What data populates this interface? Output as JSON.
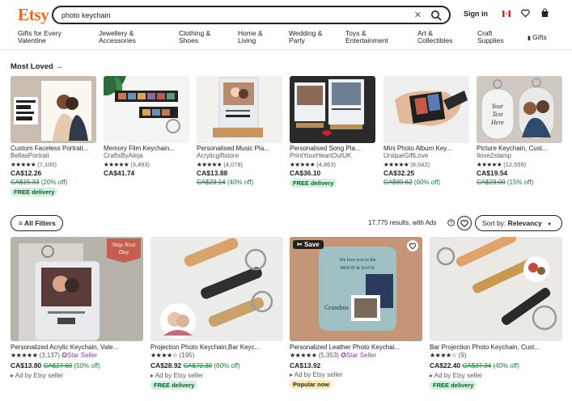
{
  "header": {
    "logo": "Etsy",
    "search_value": "photo keychain",
    "signin": "Sign in"
  },
  "nav": [
    "Gifts for Every Valentine",
    "Jewellery & Accessories",
    "Clothing & Shoes",
    "Home & Living",
    "Wedding & Party",
    "Toys & Entertainment",
    "Art & Collectibles",
    "Craft Supplies",
    "Gifts"
  ],
  "most_loved": {
    "heading": "Most Loved →",
    "items": [
      {
        "title": "Custom Faceless Portrait...",
        "shop": "BellasPortrait",
        "stars": "★★★★★",
        "reviews": "(7,100)",
        "price": "CA$12.26",
        "was": "CA$15.33",
        "discount": "(20% off)",
        "badge": "FREE delivery",
        "badge_type": "green"
      },
      {
        "title": "Memory Film Keychain...",
        "shop": "CraftsByAleja",
        "stars": "★★★★★",
        "reviews": "(3,493)",
        "price": "CA$41.74",
        "was": "",
        "discount": "",
        "badge": "",
        "badge_type": ""
      },
      {
        "title": "Personalised Music Pla...",
        "shop": "Acrylicgiftstore",
        "stars": "★★★★★",
        "reviews": "(4,078)",
        "price": "CA$13.88",
        "was": "CA$23.14",
        "discount": "(40% off)",
        "badge": "",
        "badge_type": ""
      },
      {
        "title": "Personalised Song Pla...",
        "shop": "PrintYourHeartOutUK",
        "stars": "★★★★★",
        "reviews": "(4,863)",
        "price": "CA$36.10",
        "was": "",
        "discount": "",
        "badge": "FREE delivery",
        "badge_type": "green"
      },
      {
        "title": "Mini Photo Album Key...",
        "shop": "UniqueGiftLove",
        "stars": "★★★★★",
        "reviews": "(8,042)",
        "price": "CA$32.25",
        "was": "CA$80.62",
        "discount": "(60% off)",
        "badge": "",
        "badge_type": ""
      },
      {
        "title": "Picture Keychain, Cust...",
        "shop": "Ilove2stamp",
        "stars": "★★★★★",
        "reviews": "(12,559)",
        "price": "CA$19.54",
        "was": "CA$23.00",
        "discount": "(15% off)",
        "badge": "",
        "badge_type": ""
      }
    ]
  },
  "filter_bar": {
    "all_filters": "All Filters",
    "results": "17,775 results, with Ads",
    "sort_prefix": "Sort by:",
    "sort_value": "Relevancy"
  },
  "grid": [
    {
      "title": "Personalized Acrylic Keychain, Vale...",
      "stars": "★★★★★",
      "reviews": "(3,137)",
      "star_seller": "Star Seller",
      "price": "CA$13.80",
      "was": "CA$27.60",
      "discount": "(50% off)",
      "ad": "Ad by Etsy seller",
      "badge": "",
      "badge_type": "",
      "ribbon": "Ship Next Day"
    },
    {
      "title": "Projection Photo Keychain,Bar Keyc...",
      "stars": "★★★★☆",
      "reviews": "(195)",
      "star_seller": "",
      "price": "CA$28.92",
      "was": "CA$72.30",
      "discount": "(60% off)",
      "ad": "Ad by Etsy seller",
      "badge": "FREE delivery",
      "badge_type": "green",
      "ribbon": ""
    },
    {
      "title": "Personalized Leather Photo Keychai...",
      "stars": "★★★★★",
      "reviews": "(5,353)",
      "star_seller": "Star Seller",
      "price": "CA$13.92",
      "was": "",
      "discount": "",
      "ad": "Ad by Etsy seller",
      "badge": "Popular now",
      "badge_type": "yellow",
      "ribbon": "",
      "save": "Save"
    },
    {
      "title": "Bar Projection Photo Keychain, Cust...",
      "stars": "★★★★☆",
      "reviews": "(9)",
      "star_seller": "",
      "price": "CA$22.40",
      "was": "CA$37.34",
      "discount": "(40% off)",
      "ad": "Ad by Etsy seller",
      "badge": "FREE delivery",
      "badge_type": "green",
      "ribbon": ""
    }
  ]
}
